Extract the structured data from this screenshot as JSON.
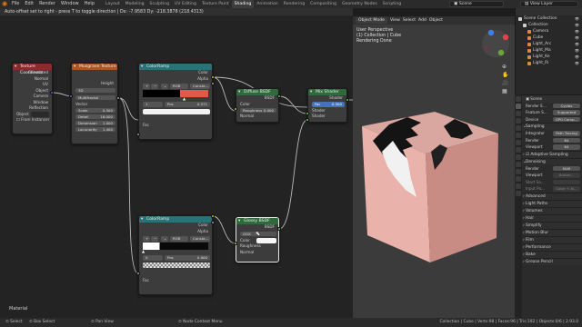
{
  "menubar": {
    "menus": [
      "File",
      "Edit",
      "Render",
      "Window",
      "Help"
    ],
    "workspaces": [
      "Layout",
      "Modeling",
      "Sculpting",
      "UV Editing",
      "Texture Paint",
      "Shading",
      "Animation",
      "Rendering",
      "Compositing",
      "Geometry Nodes",
      "Scripting"
    ],
    "active_workspace": "Shading",
    "scene": "Scene",
    "view_layer": "View Layer"
  },
  "node_editor": {
    "header_text": "Auto-offset set to right - press T to toggle direction  |  Dx: -7.9583   Dy: -218.3878 (218.4313)",
    "footer_label": "Material",
    "texture_coordinate": {
      "title": "Texture Coordinate",
      "outputs": [
        "Generated",
        "Normal",
        "UV",
        "Object",
        "Camera",
        "Window",
        "Reflection"
      ],
      "object_label": "Object",
      "from_instancer": "From Instancer"
    },
    "musgrave": {
      "title": "Musgrave Texture",
      "output": "Height",
      "dimension": "3D",
      "type": "Multifractal",
      "vector": "Vector",
      "fields": [
        {
          "label": "Scale",
          "value": "0.500"
        },
        {
          "label": "Detail",
          "value": "16.000"
        },
        {
          "label": "Dimension",
          "value": "1.000"
        },
        {
          "label": "Lacunarity",
          "value": "1.400"
        }
      ]
    },
    "colorramp_top": {
      "title": "ColorRamp",
      "outputs": [
        "Color",
        "Alpha"
      ],
      "mode": "RGB",
      "interp": "Consta...",
      "index": "1",
      "pos_label": "Pos",
      "pos_value": "0.571",
      "input": "Fac"
    },
    "diffuse": {
      "title": "Diffuse BSDF",
      "output": "BSDF",
      "color": "Color",
      "roughness_label": "Roughness",
      "roughness_value": "0.000",
      "normal": "Normal"
    },
    "mix_shader": {
      "title": "Mix Shader",
      "output": "Shader",
      "fac_label": "Fac",
      "fac_value": "0.500",
      "shader1": "Shader",
      "shader2": "Shader"
    },
    "colorramp_bottom": {
      "title": "ColorRamp",
      "outputs": [
        "Color",
        "Alpha"
      ],
      "mode": "RGB",
      "interp": "Consta...",
      "index": "0",
      "pos_label": "Pos",
      "pos_value": "0.000",
      "input": "Fac"
    },
    "glossy": {
      "title": "Glossy BSDF",
      "output": "BSDF",
      "distribution": "GGX",
      "color": "Color",
      "roughness": "Roughness",
      "normal": "Normal"
    }
  },
  "viewport": {
    "mode": "Object Mode",
    "menus": [
      "View",
      "Select",
      "Add",
      "Object"
    ],
    "overlay_lines": [
      "User Perspective",
      "(1) Collection | Cube",
      "Rendering Done"
    ]
  },
  "outliner": {
    "items": [
      {
        "label": "Scene Collection",
        "color": "#cfcfcf",
        "indent": 0
      },
      {
        "label": "Collection",
        "color": "#cfcfcf",
        "indent": 1
      },
      {
        "label": "Camera",
        "color": "#e0893a",
        "indent": 2
      },
      {
        "label": "Cube",
        "color": "#e0893a",
        "indent": 2
      },
      {
        "label": "Light_Arc",
        "color": "#e0893a",
        "indent": 2
      },
      {
        "label": "Light_Ma",
        "color": "#e0893a",
        "indent": 2
      },
      {
        "label": "Light_Ke",
        "color": "#e0893a",
        "indent": 2
      },
      {
        "label": "Light_Ri",
        "color": "#e0893a",
        "indent": 2
      }
    ]
  },
  "properties": {
    "scene_label": "Scene",
    "rows": [
      {
        "label": "Render E...",
        "value": "Cycles"
      },
      {
        "label": "Feature S...",
        "value": "Supported"
      },
      {
        "label": "Device",
        "value": "GPU Comp..."
      }
    ],
    "sampling": "Sampling",
    "integrator_label": "Integrator",
    "integrator_value": "Path Tracing",
    "render_label": "Render",
    "render_value": "64",
    "viewport_label": "Viewport",
    "viewport_value": "64",
    "adaptive": "Adaptive Sampling",
    "denoising": "Denoising",
    "denoise_render_label": "Render",
    "denoise_render_value": "NLM",
    "denoise_viewport_label": "Viewport",
    "denoise_viewport_value": "Autom...",
    "start_label": "Start Sa...",
    "input_label": "Input Pa...",
    "input_value": "Color + Al...",
    "sections": [
      "Advanced",
      "Light Paths",
      "Volumes",
      "Hair",
      "Simplify",
      "Motion Blur",
      "Film",
      "Performance",
      "Bake",
      "Grease Pencil"
    ]
  },
  "statusbar": {
    "left": [
      "Select",
      "Box Select",
      "Pan View",
      "Node Context Menu"
    ],
    "right": "Collection | Cube | Verts:98 | Faces:96 | Tris:192 | Objects:0/6 | 2.93.0"
  }
}
